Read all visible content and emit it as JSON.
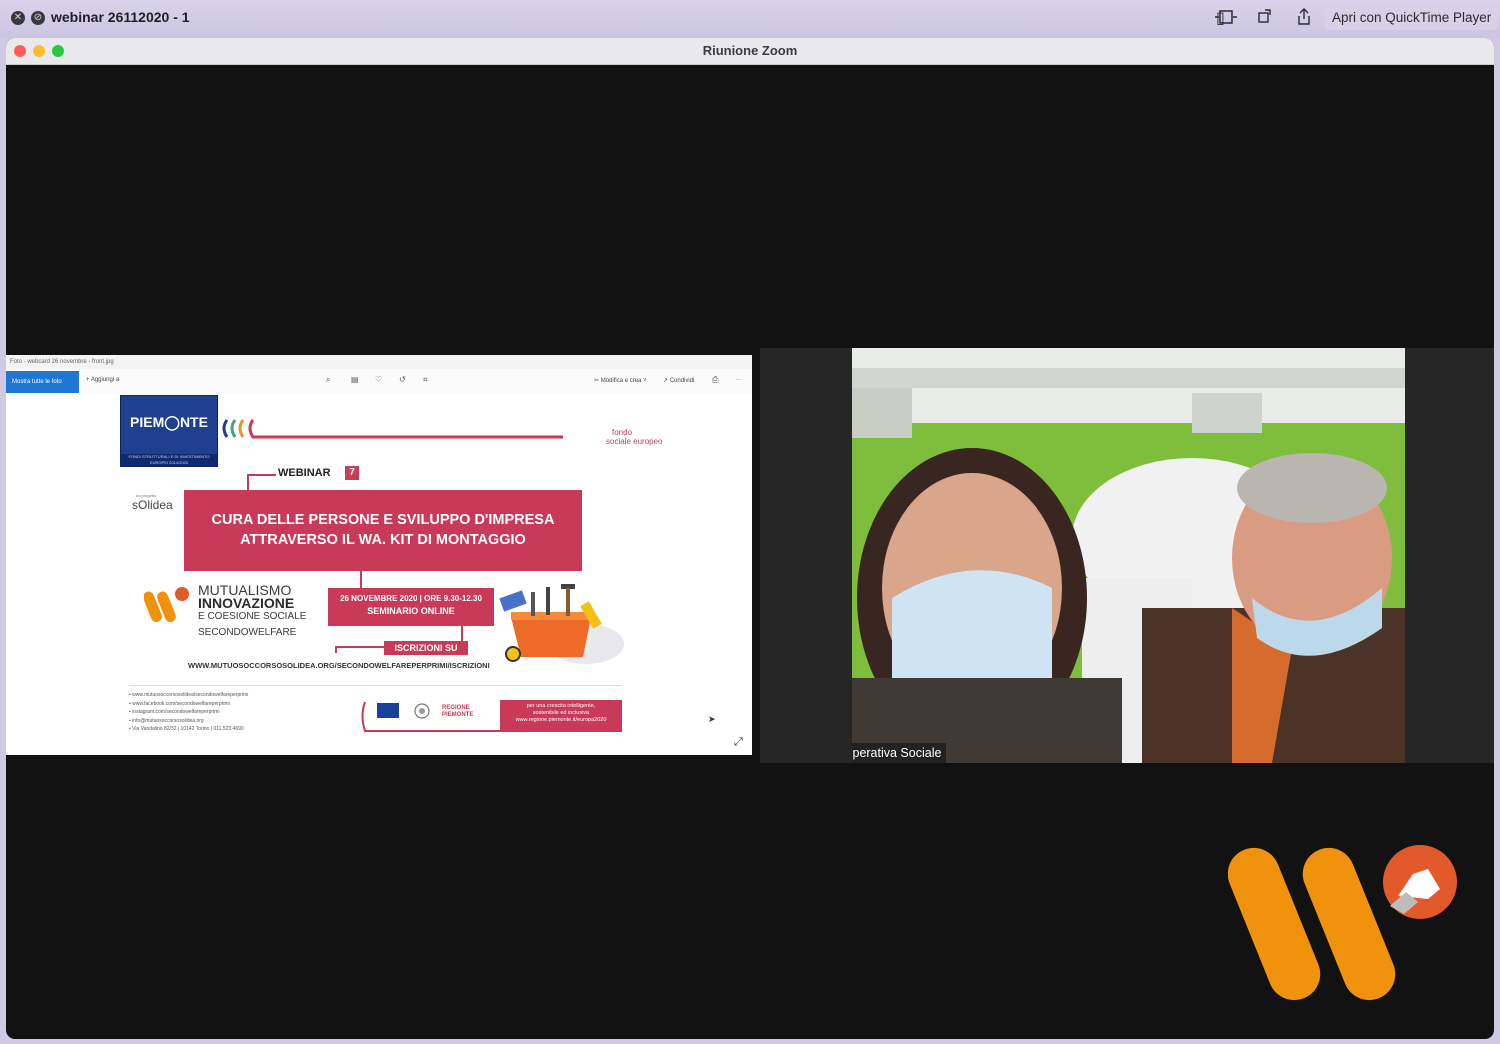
{
  "qt": {
    "title": "webinar 26112020 - 1",
    "close_glyph": "✕",
    "skip_glyph": "⊘",
    "open_label": "Apri con QuickTime Player"
  },
  "zoom": {
    "title": "Riunione Zoom"
  },
  "share": {
    "photos_title": "Foto - webcard 26 novembre - front.jpg",
    "toolbar": {
      "show_all": "Mostra tutte le foto",
      "add_to": "+ Aggiungi a",
      "edit": "Modifica e crea",
      "share": "Condividi",
      "more": "···"
    },
    "flyer": {
      "piemonte": "PIEM◯NTE",
      "piemonte_band": "FONDI STRUTTURALI E DI INVESTIMENTO EUROPEI 2014/2020",
      "fse_line1": "fondo",
      "fse_line2": "sociale europeo",
      "webinar": "WEBINAR",
      "webinar_num": "7",
      "solidea_pre": "un progetto",
      "solidea": "sOlidea",
      "cura_line1": "CURA DELLE PERSONE E SVILUPPO D'IMPRESA",
      "cura_line2": "ATTRAVERSO IL WA. KIT DI MONTAGGIO",
      "mutual_line1": "MUTUALISMO",
      "mutual_line2": "INNOVAZIONE",
      "mutual_line3": "E COESIONE SOCIALE",
      "mutual_line4": "SECONDOWELFARE",
      "date_line1": "26 NOVEMBRE 2020 | ORE 9.30-12.30",
      "date_line2": "SEMINARIO ONLINE",
      "iscrizioni": "ISCRIZIONI SU",
      "url": "WWW.MUTUOSOCCORSOSOLIDEA.ORG/SECONDOWELFAREPERPRIMI/ISCRIZIONI",
      "contacts": [
        "www.mutuosoccorsosolidea/secondowelfareperprimi",
        "www.facebook.com/secondowelfareperprimi",
        "instagram.com/secondowelfareperprimi",
        "info@mutuosoccorsosolidea.org",
        "Via Vandalino 82/32 | 10142 Torino | 011.523 4690"
      ],
      "regione_line1": "REGIONE",
      "regione_line2": "PIEMONTE",
      "crescita_line1": "per una crescita intelligente,",
      "crescita_line2": "sostenibile ed inclusiva",
      "crescita_line3": "www.regione.piemonte.it/europa2020"
    }
  },
  "video": {
    "participant_name": "Agridea Cooperativa Sociale"
  },
  "colors": {
    "accent_red": "#c83a57",
    "orange": "#f0920c",
    "brand_orange_red": "#e25a2a"
  }
}
